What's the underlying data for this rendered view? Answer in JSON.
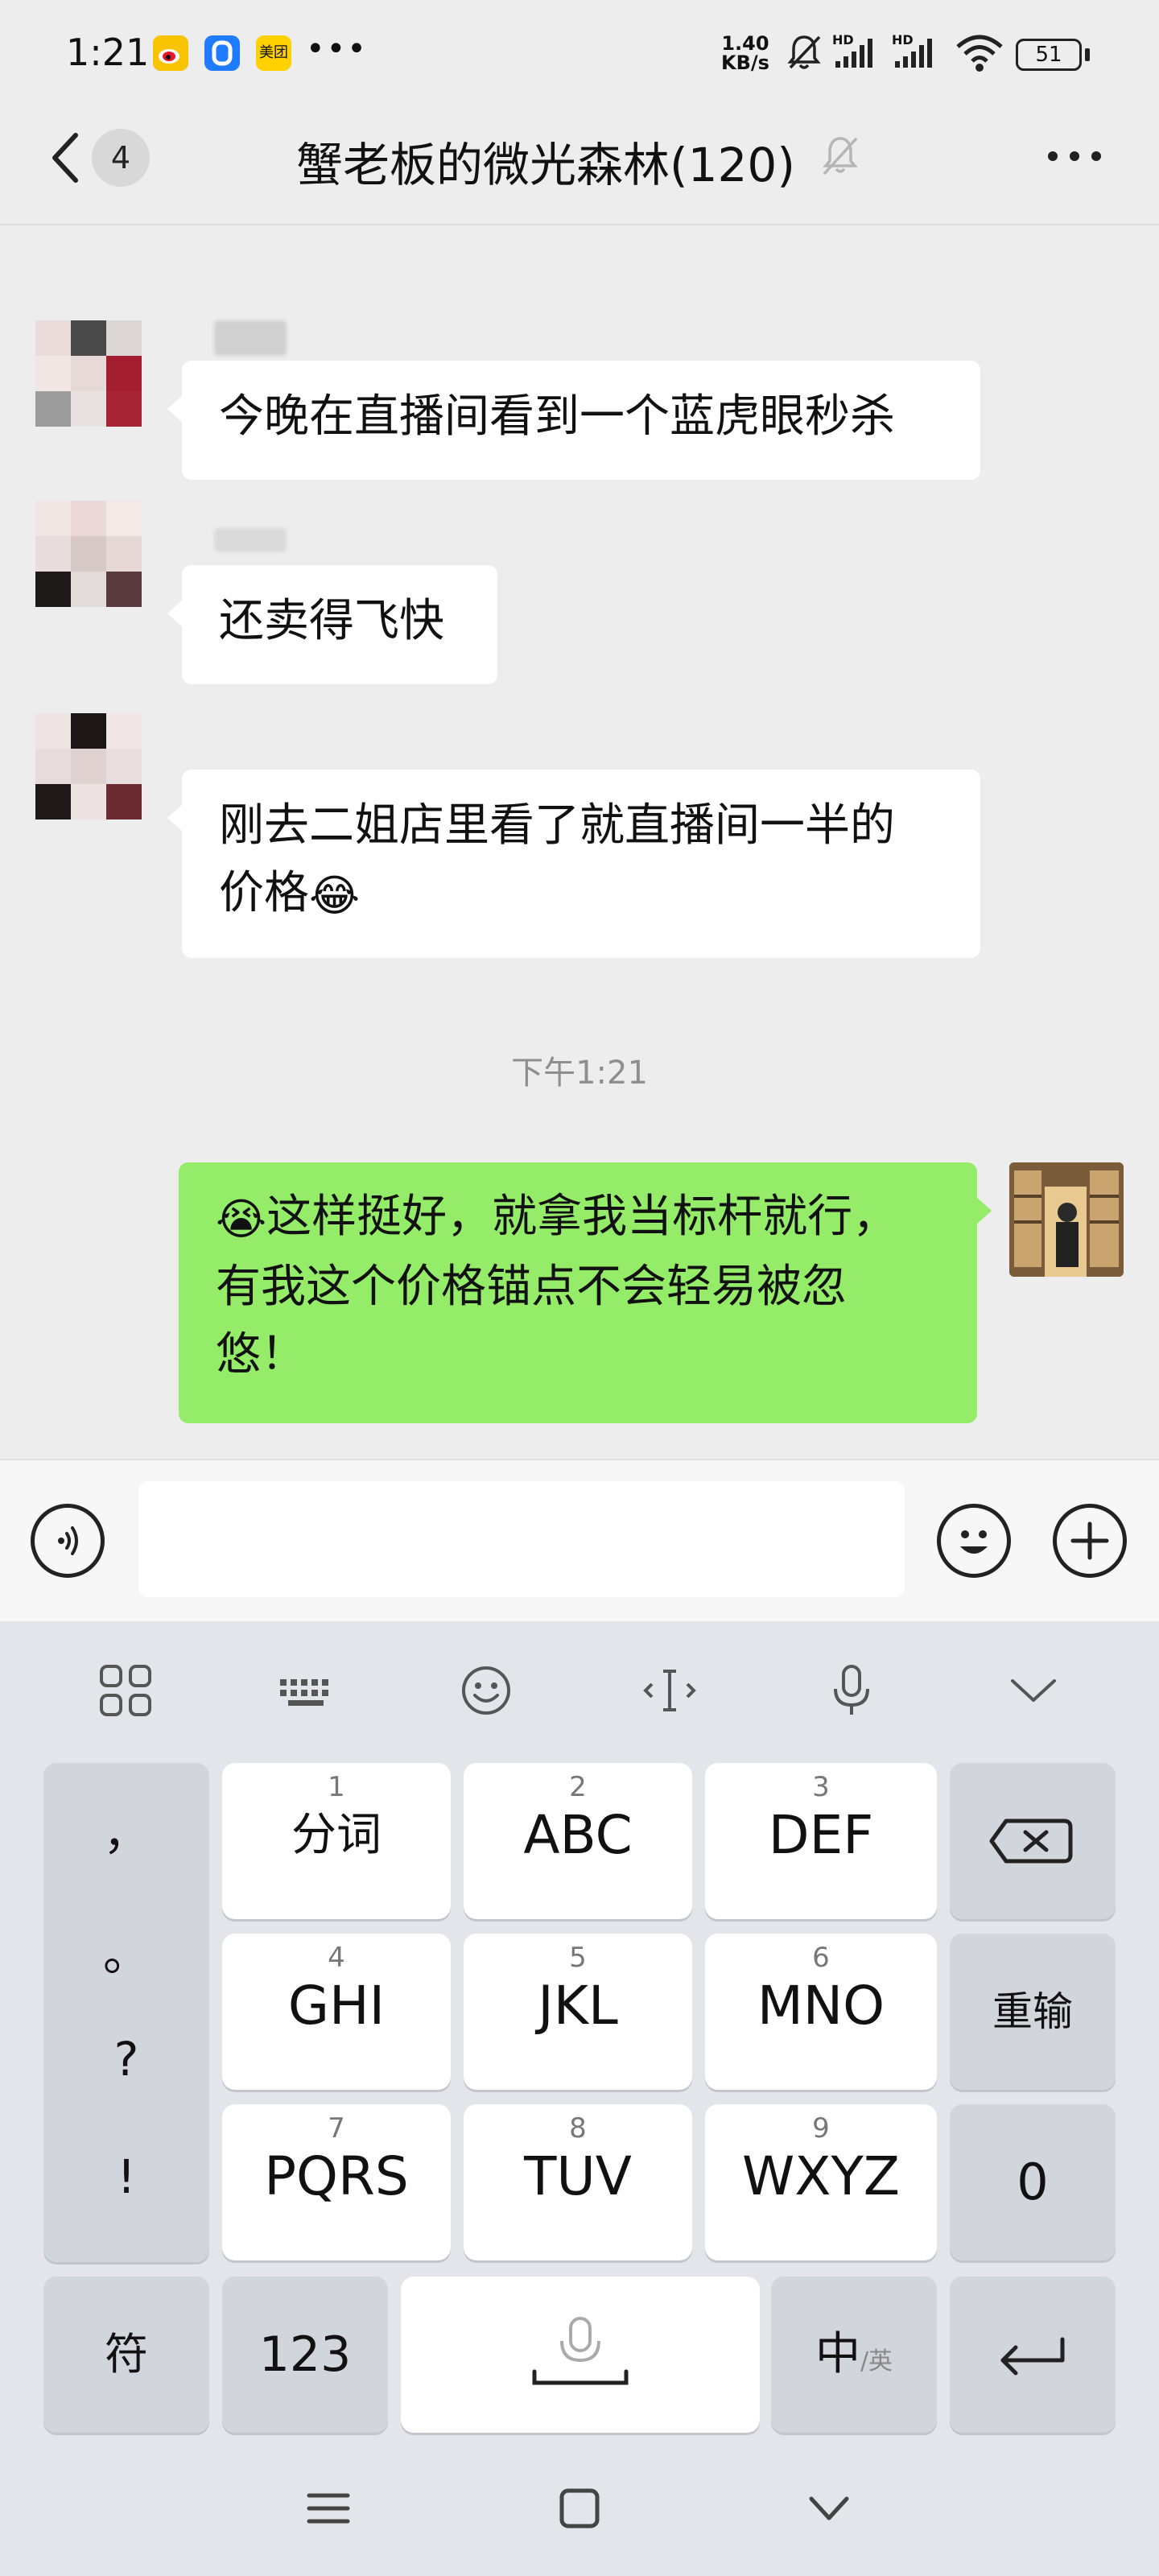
{
  "status_bar": {
    "time": "1:21",
    "app_icons": [
      "weibo-icon",
      "shield-u-icon",
      "meituan-icon"
    ],
    "app_label_meituan": "美团",
    "more": "•••",
    "speed_value": "1.40",
    "speed_unit": "KB/s",
    "signal_label_1": "HD",
    "signal_label_2": "HD",
    "battery": "51"
  },
  "header": {
    "unread_count": "4",
    "title": "蟹老板的微光森林(120)"
  },
  "chat": {
    "messages": [
      {
        "text": "今晚在直播间看到一个蓝虎眼秒杀"
      },
      {
        "text": "还卖得飞快"
      },
      {
        "text_line1": "刚去二姐店里看了就直播间一半的",
        "text_line2": "价格",
        "emoji": "😂"
      },
      {
        "emoji": "😭",
        "text_line1": "这样挺好，就拿我当标杆就行，",
        "text_line2": "有我这个价格锚点不会轻易被忽",
        "text_line3": "悠！"
      }
    ],
    "time_divider": "下午1:21"
  },
  "keyboard": {
    "keys": [
      {
        "num": "1",
        "label": "分词"
      },
      {
        "num": "2",
        "label": "ABC"
      },
      {
        "num": "3",
        "label": "DEF"
      },
      {
        "num": "4",
        "label": "GHI"
      },
      {
        "num": "5",
        "label": "JKL"
      },
      {
        "num": "6",
        "label": "MNO"
      },
      {
        "num": "7",
        "label": "PQRS"
      },
      {
        "num": "8",
        "label": "TUV"
      },
      {
        "num": "9",
        "label": "WXYZ"
      }
    ],
    "punctuation": [
      "，",
      "。",
      "?",
      "!"
    ],
    "reinput": "重输",
    "zero": "0",
    "symbols": "符",
    "numbers": "123",
    "lang_main": "中",
    "lang_sub": "/英"
  },
  "colors": {
    "my_bubble": "#95ec69",
    "other_bubble": "#ffffff",
    "background": "#ededed"
  }
}
